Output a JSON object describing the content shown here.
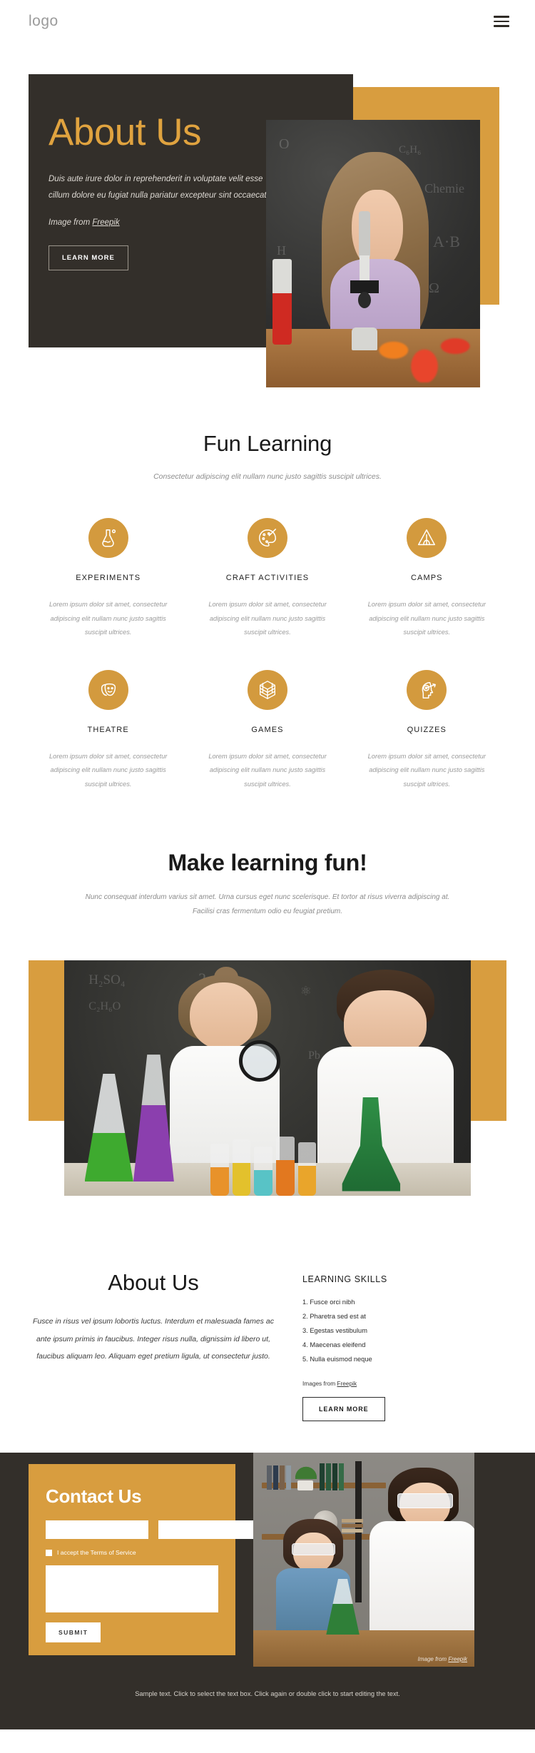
{
  "header": {
    "logo": "logo",
    "menu_icon": "hamburger-icon"
  },
  "hero": {
    "title": "About Us",
    "description": "Duis aute irure dolor in reprehenderit in voluptate velit esse cillum dolore eu fugiat nulla pariatur excepteur sint occaecat.",
    "credit_prefix": "Image from ",
    "credit_link": "Freepik",
    "cta": "LEARN MORE",
    "image_alt": "Girl looking through a microscope in front of a chalkboard"
  },
  "fun_learning": {
    "title": "Fun Learning",
    "subtitle": "Consectetur adipiscing elit nullam nunc justo sagittis suscipit ultrices.",
    "features": [
      {
        "name": "EXPERIMENTS",
        "icon": "flask-icon",
        "text": "Lorem ipsum dolor sit amet, consectetur adipiscing elit nullam nunc justo sagittis suscipit ultrices."
      },
      {
        "name": "CRAFT ACTIVITIES",
        "icon": "palette-icon",
        "text": "Lorem ipsum dolor sit amet, consectetur adipiscing elit nullam nunc justo sagittis suscipit ultrices."
      },
      {
        "name": "CAMPS",
        "icon": "tent-icon",
        "text": "Lorem ipsum dolor sit amet, consectetur adipiscing elit nullam nunc justo sagittis suscipit ultrices."
      },
      {
        "name": "THEATRE",
        "icon": "theatre-masks-icon",
        "text": "Lorem ipsum dolor sit amet, consectetur adipiscing elit nullam nunc justo sagittis suscipit ultrices."
      },
      {
        "name": "GAMES",
        "icon": "rubiks-cube-icon",
        "text": "Lorem ipsum dolor sit amet, consectetur adipiscing elit nullam nunc justo sagittis suscipit ultrices."
      },
      {
        "name": "QUIZZES",
        "icon": "head-target-icon",
        "text": "Lorem ipsum dolor sit amet, consectetur adipiscing elit nullam nunc justo sagittis suscipit ultrices."
      }
    ]
  },
  "make_fun": {
    "title": "Make learning fun!",
    "subtitle": "Nunc consequat interdum varius sit amet. Urna cursus eget nunc scelerisque. Et tortor at risus viverra adipiscing at. Facilisi cras fermentum odio eu feugiat pretium.",
    "image_alt": "Two children in lab coats doing a science experiment"
  },
  "about2": {
    "title": "About Us",
    "body": "Fusce in risus vel ipsum lobortis luctus. Interdum et malesuada fames ac ante ipsum primis in faucibus. Integer risus nulla, dignissim id libero ut, faucibus aliquam leo. Aliquam eget pretium ligula, ut consectetur justo.",
    "skills_title": "LEARNING SKILLS",
    "skills": [
      "1. Fusce orci nibh",
      "2. Pharetra sed est at",
      "3. Egestas vestibulum",
      "4. Maecenas eleifend",
      "5. Nulla euismod neque"
    ],
    "credit_prefix": "Images from ",
    "credit_link": "Freepik",
    "cta": "LEARN MORE"
  },
  "contact": {
    "title": "Contact Us",
    "field1_value": "",
    "field1_placeholder": "",
    "field2_value": "",
    "field2_placeholder": "",
    "terms_label": "I accept the Terms of Service",
    "message_value": "",
    "message_placeholder": "",
    "submit": "SUBMIT",
    "image_credit_prefix": "Image from ",
    "image_credit_link": "Freepik",
    "image_alt": "Teacher and child doing a chemistry experiment"
  },
  "footer": {
    "text": "Sample text. Click to select the text box. Click again or double click to start editing the text."
  },
  "colors": {
    "accent": "#d89d3f",
    "dark": "#332f2a",
    "hero_title": "#e0a33f",
    "muted_text": "#9a9a9a"
  }
}
